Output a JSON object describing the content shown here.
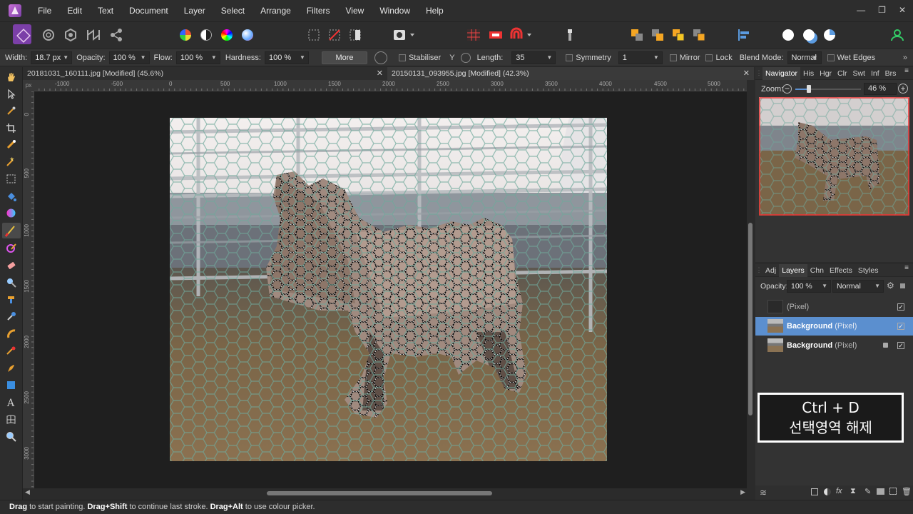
{
  "menu": [
    "File",
    "Edit",
    "Text",
    "Document",
    "Layer",
    "Select",
    "Arrange",
    "Filters",
    "View",
    "Window",
    "Help"
  ],
  "window_controls": [
    "—",
    "❐",
    "✕"
  ],
  "context": {
    "width_label": "Width:",
    "width_value": "18.7 px",
    "opacity_label": "Opacity:",
    "opacity_value": "100 %",
    "flow_label": "Flow:",
    "flow_value": "100 %",
    "hardness_label": "Hardness:",
    "hardness_value": "100 %",
    "more_label": "More",
    "stabiliser_label": "Stabiliser",
    "length_label": "Length:",
    "length_value": "35",
    "symmetry_label": "Symmetry",
    "symmetry_value": "1",
    "mirror_label": "Mirror",
    "lock_label": "Lock",
    "blend_label": "Blend Mode:",
    "blend_value": "Normal",
    "wet_label": "Wet Edges"
  },
  "tabs": [
    {
      "label": "20181031_160111.jpg [Modified] (45.6%)",
      "close": "✕"
    },
    {
      "label": "20150131_093955.jpg [Modified] (42.3%)",
      "close": "✕"
    }
  ],
  "ruler": {
    "unit": "px",
    "h_ticks": [
      "-1000",
      "-500",
      "0",
      "500",
      "1000",
      "1500",
      "2000",
      "2500",
      "3000",
      "3500",
      "4000",
      "4500",
      "5000"
    ],
    "v_ticks": [
      "0",
      "500",
      "1000",
      "1500",
      "2000",
      "2500",
      "3000"
    ]
  },
  "status": {
    "drag": "Drag",
    "t1": " to start painting. ",
    "dragshift_a": "Drag",
    "dragshift_b": "+Shift",
    "t2": " to continue last stroke. ",
    "dragalt_a": "Drag",
    "dragalt_b": "+Alt",
    "t3": " to use colour picker."
  },
  "navigator": {
    "tabs": [
      "Navigator",
      "His",
      "Hgr",
      "Clr",
      "Swt",
      "Inf",
      "Brs"
    ],
    "zoom_label": "Zoom:",
    "zoom_value": "46 %",
    "zoom_level": 0.46
  },
  "layers_panel": {
    "tabs": [
      "Adj",
      "Layers",
      "Chn",
      "Effects",
      "Styles"
    ],
    "opacity_label": "Opacity:",
    "opacity_value": "100 %",
    "blend_value": "Normal",
    "layers": [
      {
        "name": "",
        "type": "(Pixel)",
        "checked": "✓"
      },
      {
        "name": "Background",
        "type": "(Pixel)",
        "checked": "✓"
      },
      {
        "name": "Background",
        "type": "(Pixel)",
        "checked": "✓"
      }
    ]
  },
  "overlay": {
    "line1": "Ctrl + D",
    "line2": "선택영역 해제"
  },
  "colors": {
    "accent": "#5b8fcf",
    "brand": "#7b3fa8",
    "selection": "#ffffff"
  }
}
